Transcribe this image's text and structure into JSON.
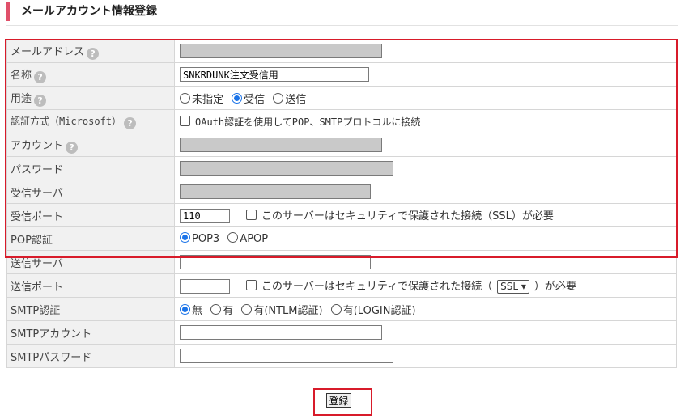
{
  "page_title": "メールアカウント情報登録",
  "help_icon": "?",
  "rows": {
    "email": {
      "label": "メールアドレス"
    },
    "name": {
      "label": "名称",
      "value": "SNKRDUNK注文受信用"
    },
    "usage": {
      "label": "用途",
      "options": [
        "未指定",
        "受信",
        "送信"
      ],
      "selected": "受信"
    },
    "auth_method": {
      "label": "認証方式（Microsoft）",
      "checkbox_label": "OAuth認証を使用してPOP、SMTPプロトコルに接続"
    },
    "account": {
      "label": "アカウント"
    },
    "password": {
      "label": "パスワード"
    },
    "recv_server": {
      "label": "受信サーバ"
    },
    "recv_port": {
      "label": "受信ポート",
      "value": "110",
      "ssl_label": "このサーバーはセキュリティで保護された接続（SSL）が必要"
    },
    "pop_auth": {
      "label": "POP認証",
      "options": [
        "POP3",
        "APOP"
      ],
      "selected": "POP3"
    },
    "send_server": {
      "label": "送信サーバ"
    },
    "send_port": {
      "label": "送信ポート",
      "ssl_prefix": "このサーバーはセキュリティで保護された接続（",
      "ssl_select": "SSL",
      "ssl_suffix": "）が必要"
    },
    "smtp_auth": {
      "label": "SMTP認証",
      "options": [
        "無",
        "有",
        "有(NTLM認証)",
        "有(LOGIN認証)"
      ],
      "selected": "無"
    },
    "smtp_account": {
      "label": "SMTPアカウント"
    },
    "smtp_password": {
      "label": "SMTPパスワード"
    }
  },
  "submit_label": "登録",
  "colors": {
    "accent": "#e0506a",
    "highlight": "#d81b2a",
    "radio_selected": "#1a73e8"
  }
}
